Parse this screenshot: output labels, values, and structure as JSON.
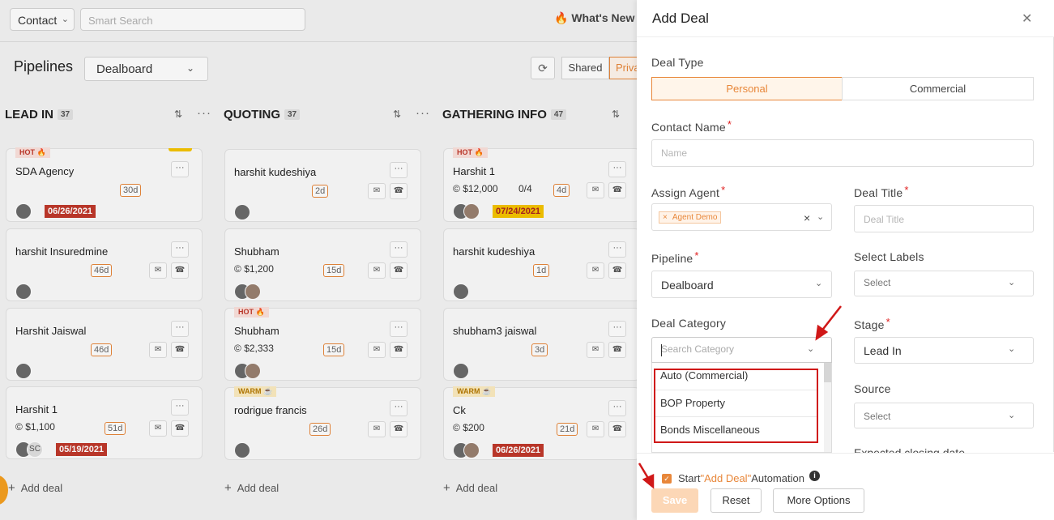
{
  "topbar": {
    "contact_select": "Contact",
    "search_placeholder": "Smart Search",
    "whats_new": "What's New"
  },
  "pipeline_bar": {
    "title": "Pipelines",
    "pipeline_select": "Dealboard",
    "shared_label": "Shared",
    "private_label": "Private"
  },
  "columns": [
    {
      "title": "LEAD IN",
      "count": "37",
      "add_label": "Add deal"
    },
    {
      "title": "QUOTING",
      "count": "37",
      "add_label": "Add deal"
    },
    {
      "title": "GATHERING INFO",
      "count": "47",
      "add_label": "Add deal"
    }
  ],
  "cards": {
    "c1": {
      "badge": "HOT",
      "name": "SDA Agency",
      "days": "30d",
      "date": "06/26/2021"
    },
    "c2": {
      "name": "harshit Insuredmine",
      "days": "46d"
    },
    "c3": {
      "name": "Harshit Jaiswal",
      "days": "46d"
    },
    "c4": {
      "name": "Harshit 1",
      "amount": "$1,100",
      "days": "51d",
      "initials": "SC",
      "date": "05/19/2021"
    },
    "q1": {
      "name": "harshit kudeshiya",
      "days": "2d"
    },
    "q2": {
      "name": "Shubham",
      "amount": "$1,200",
      "days": "15d"
    },
    "q3": {
      "badge": "HOT",
      "name": "Shubham",
      "amount": "$2,333",
      "days": "15d"
    },
    "q4": {
      "badge": "WARM",
      "name": "rodrigue francis",
      "days": "26d"
    },
    "g1": {
      "badge": "HOT",
      "name": "Harshit 1",
      "amount": "$12,000",
      "progress": "0/4",
      "days": "4d",
      "date": "07/24/2021"
    },
    "g2": {
      "name": "harshit kudeshiya",
      "days": "1d"
    },
    "g3": {
      "name": "shubham3 jaiswal",
      "days": "3d"
    },
    "g4": {
      "badge": "WARM",
      "name": "Ck",
      "amount": "$200",
      "days": "21d",
      "date": "06/26/2021"
    }
  },
  "drawer": {
    "title": "Add Deal",
    "deal_type_label": "Deal Type",
    "deal_type_personal": "Personal",
    "deal_type_commercial": "Commercial",
    "contact_name_label": "Contact Name",
    "contact_name_placeholder": "Name",
    "assign_agent_label": "Assign Agent",
    "assign_agent_tag": "Agent Demo",
    "deal_title_label": "Deal Title",
    "deal_title_placeholder": "Deal Title",
    "pipeline_label": "Pipeline",
    "pipeline_value": "Dealboard",
    "labels_label": "Select Labels",
    "labels_placeholder": "Select",
    "category_label": "Deal Category",
    "category_placeholder": "Search Category",
    "category_options": [
      "Auto (Commercial)",
      "BOP Property",
      "Bonds Miscellaneous"
    ],
    "stage_label": "Stage",
    "stage_value": "Lead In",
    "source_label": "Source",
    "source_placeholder": "Select",
    "expected_label": "Expected closing date",
    "automation_prefix": "Start",
    "automation_highlight": "\"Add Deal\"",
    "automation_suffix": "Automation",
    "save_label": "Save",
    "reset_label": "Reset",
    "more_label": "More Options"
  },
  "colors": {
    "accent": "#e8873a",
    "hot_date": "#c0392b",
    "annotation": "#d01818"
  }
}
